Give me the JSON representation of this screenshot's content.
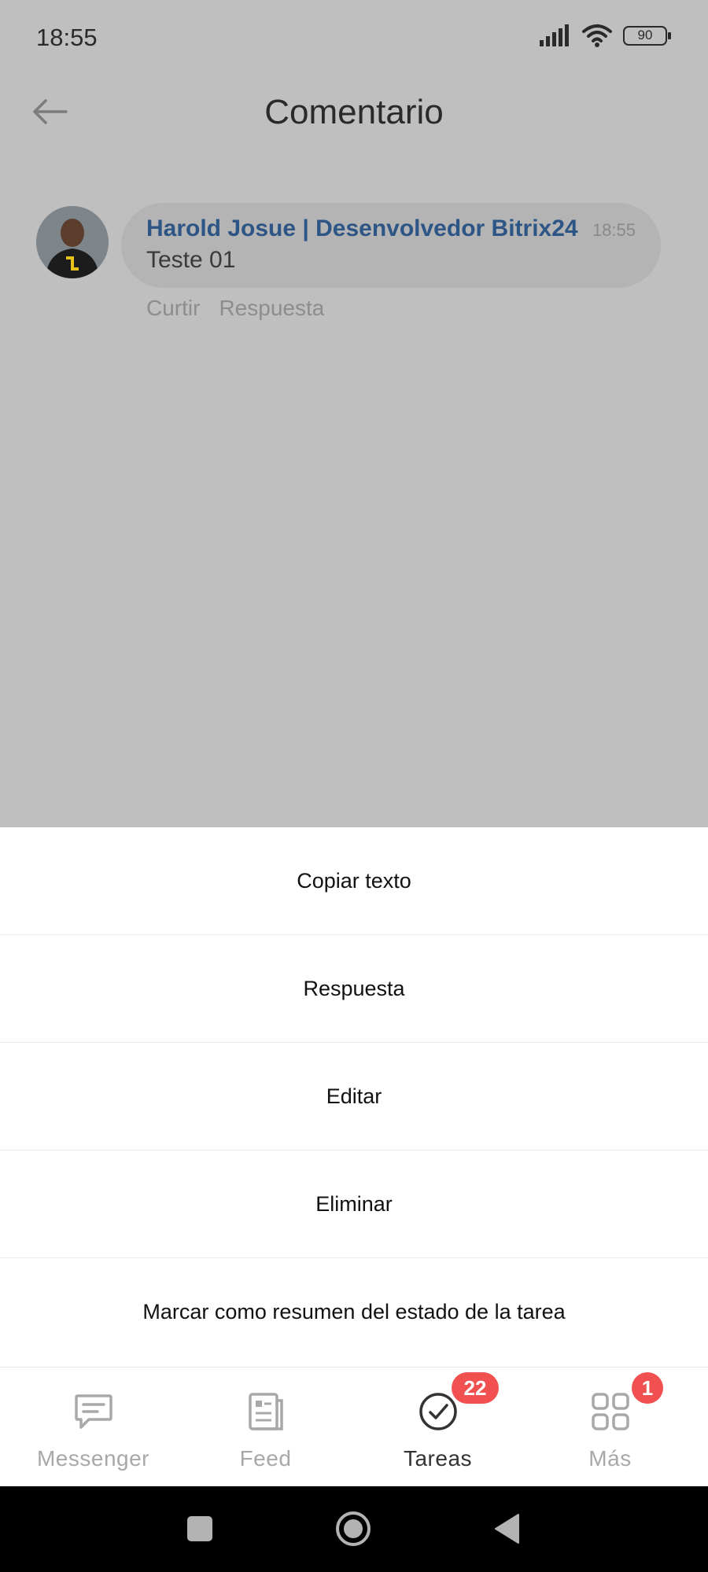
{
  "status_bar": {
    "time": "18:55",
    "battery": "90"
  },
  "header": {
    "title": "Comentario"
  },
  "comment": {
    "author": "Harold Josue | Desenvolvedor Bitrix24",
    "time": "18:55",
    "text": "Teste 01",
    "like_label": "Curtir",
    "reply_label": "Respuesta"
  },
  "action_sheet": {
    "items": [
      {
        "label": "Copiar texto"
      },
      {
        "label": "Respuesta"
      },
      {
        "label": "Editar"
      },
      {
        "label": "Eliminar"
      },
      {
        "label": "Marcar como resumen del estado de la tarea"
      }
    ]
  },
  "tabbar": {
    "tabs": [
      {
        "label": "Messenger",
        "icon": "chat-bubble-icon",
        "active": false
      },
      {
        "label": "Feed",
        "icon": "feed-document-icon",
        "active": false
      },
      {
        "label": "Tareas",
        "icon": "check-circle-icon",
        "active": true,
        "badge": "22"
      },
      {
        "label": "Más",
        "icon": "grid-icon",
        "active": false,
        "badge": "1"
      }
    ]
  },
  "colors": {
    "author_link": "#2d5586",
    "badge": "#f0504f",
    "overlay_background": "#bfbfbf"
  }
}
